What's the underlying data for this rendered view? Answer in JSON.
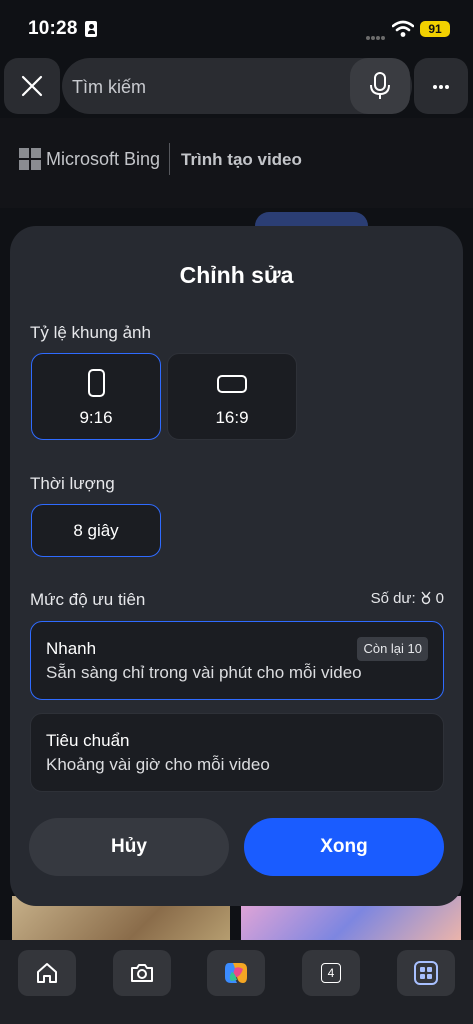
{
  "status_bar": {
    "time": "10:28",
    "battery": "91"
  },
  "top_bar": {
    "search_placeholder": "Tìm kiếm"
  },
  "bing_header": {
    "brand": "Microsoft Bing",
    "product": "Trình tạo video"
  },
  "modal": {
    "title": "Chỉnh sửa",
    "aspect_ratio": {
      "label": "Tỷ lệ khung ảnh",
      "options": [
        {
          "label": "9:16",
          "icon": "portrait-frame-icon",
          "selected": true
        },
        {
          "label": "16:9",
          "icon": "landscape-frame-icon",
          "selected": false
        }
      ]
    },
    "duration": {
      "label": "Thời lượng",
      "value": "8 giây"
    },
    "priority": {
      "label": "Mức độ ưu tiên",
      "balance_label": "Số dư:",
      "balance_value": "0",
      "options": [
        {
          "title": "Nhanh",
          "description": "Sẵn sàng chỉ trong vài phút cho mỗi video",
          "badge": "Còn lại 10",
          "selected": true
        },
        {
          "title": "Tiêu chuẩn",
          "description": "Khoảng vài giờ cho mỗi video",
          "selected": false
        }
      ]
    },
    "cancel_label": "Hủy",
    "done_label": "Xong"
  },
  "bottom_nav": {
    "tab_count": "4",
    "items": [
      "home-icon",
      "camera-icon",
      "copilot-icon",
      "tabs-icon",
      "apps-icon"
    ]
  },
  "colors": {
    "accent": "#1a5cff",
    "selected_border": "#2f6bff",
    "modal_bg": "#272a31",
    "battery": "#f2d100"
  }
}
